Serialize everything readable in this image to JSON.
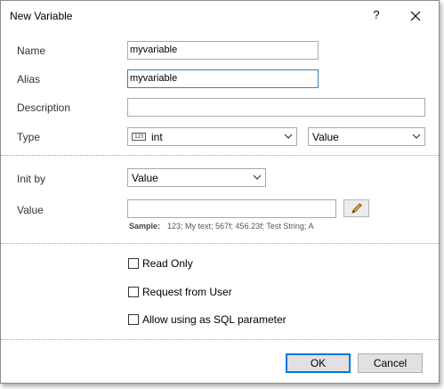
{
  "dialog": {
    "title": "New Variable",
    "help_label": "?"
  },
  "fields": {
    "name": {
      "label": "Name",
      "value": "myvariable"
    },
    "alias": {
      "label": "Alias",
      "value": "myvariable"
    },
    "description": {
      "label": "Description",
      "value": ""
    },
    "type": {
      "label": "Type",
      "type_icon": "123",
      "type_value": "int",
      "kind_value": "Value"
    }
  },
  "init": {
    "init_by_label": "Init by",
    "init_by_value": "Value",
    "value_label": "Value",
    "value": "",
    "sample_label": "Sample:",
    "sample_text": "123; My text; 567f; 456.23f; Test String; A"
  },
  "options": {
    "read_only": {
      "label": "Read Only",
      "checked": false
    },
    "request_from_user": {
      "label": "Request from User",
      "checked": false
    },
    "allow_sql_param": {
      "label": "Allow using as SQL parameter",
      "checked": false
    }
  },
  "buttons": {
    "ok": "OK",
    "cancel": "Cancel"
  },
  "colors": {
    "focus_border": "#3c7fb1",
    "default_button_border": "#0078d7",
    "pencil": "#e8a317"
  }
}
